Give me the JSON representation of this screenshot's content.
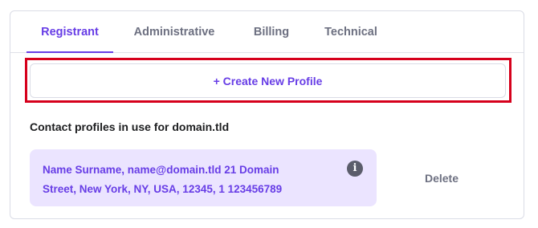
{
  "tabs": [
    {
      "label": "Registrant",
      "active": true
    },
    {
      "label": "Administrative",
      "active": false
    },
    {
      "label": "Billing",
      "active": false
    },
    {
      "label": "Technical",
      "active": false
    }
  ],
  "create_profile": {
    "label": "+ Create New Profile"
  },
  "contacts": {
    "title": "Contact profiles in use for domain.tld",
    "profile_line1": "Name Surname, name@domain.tld 21 Domain",
    "profile_line2": "Street, New York, NY, USA, 12345, 1 123456789",
    "info_icon": "info-icon",
    "delete_label": "Delete"
  },
  "colors": {
    "accent": "#673de6",
    "highlight_border": "#d6001c",
    "profile_bg": "#ebe4ff"
  }
}
